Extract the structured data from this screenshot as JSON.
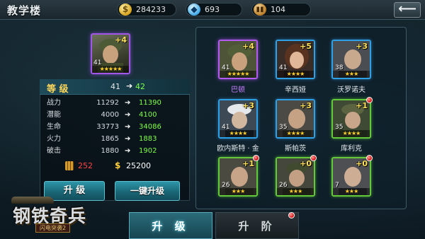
{
  "header": {
    "title": "教学楼",
    "gold": "284233",
    "gems": "693",
    "ammo": "104",
    "back_icon": "back-arrow-icon"
  },
  "selected_hero": {
    "level": "41",
    "plus": "+4",
    "stars": "★★★★★"
  },
  "level_row": {
    "label": "等 级",
    "current": "41",
    "arrow": "➔",
    "next": "42"
  },
  "stats": [
    {
      "name": "战力",
      "current": "11292",
      "arrow": "➔",
      "next": "11390"
    },
    {
      "name": "潜能",
      "current": "4000",
      "arrow": "➔",
      "next": "4100"
    },
    {
      "name": "生命",
      "current": "33773",
      "arrow": "➔",
      "next": "34086"
    },
    {
      "name": "火力",
      "current": "1865",
      "arrow": "➔",
      "next": "1883"
    },
    {
      "name": "破击",
      "current": "1880",
      "arrow": "➔",
      "next": "1902"
    }
  ],
  "cost": {
    "ammo": "252",
    "gold_symbol": "$",
    "gold": "25200"
  },
  "buttons": {
    "upgrade": "升 级",
    "one_click": "一键升级"
  },
  "logo": {
    "main": "钢铁奇兵",
    "sub": "闪电突袭2"
  },
  "heroes": [
    {
      "name": "巴顿",
      "level": "41",
      "plus": "+4",
      "stars": "★★★★★",
      "rarity": "purple",
      "alert": false
    },
    {
      "name": "辛西娅",
      "level": "41",
      "plus": "+5",
      "stars": "★★★★",
      "rarity": "blue",
      "alert": false
    },
    {
      "name": "沃罗诺夫",
      "level": "38",
      "plus": "+3",
      "stars": "★★★",
      "rarity": "blue",
      "alert": false
    },
    {
      "name": "欧内斯特 · 金",
      "level": "41",
      "plus": "+3",
      "stars": "★★★★",
      "rarity": "blue",
      "alert": false
    },
    {
      "name": "斯帕茨",
      "level": "35",
      "plus": "+3",
      "stars": "★★★★",
      "rarity": "blue",
      "alert": false
    },
    {
      "name": "库利克",
      "level": "35",
      "plus": "+1",
      "stars": "★★★★",
      "rarity": "green",
      "alert": true
    },
    {
      "name": "",
      "level": "26",
      "plus": "+1",
      "stars": "★★★",
      "rarity": "green",
      "alert": true
    },
    {
      "name": "",
      "level": "26",
      "plus": "+0",
      "stars": "★★★",
      "rarity": "green",
      "alert": true
    },
    {
      "name": "",
      "level": "7",
      "plus": "+0",
      "stars": "★★★",
      "rarity": "green",
      "alert": true
    }
  ],
  "tabs": {
    "upgrade": "升 级",
    "advance": "升 阶"
  },
  "colors": {
    "purple_rarity": "#b35bf0",
    "blue_rarity": "#2ea0e6",
    "green_rarity": "#63c93a",
    "next_value_green": "#7dff4a",
    "level_label_yellow": "#ffd75a",
    "cost_red": "#ff4545"
  }
}
